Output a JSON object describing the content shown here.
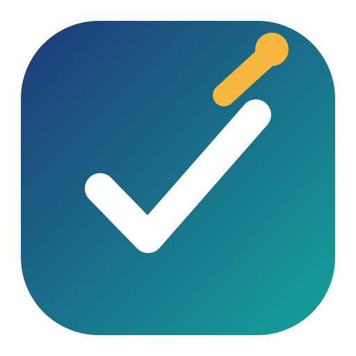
{
  "icon": {
    "name": "checkmark-app-icon",
    "gradient_start": "#1E3A78",
    "gradient_end": "#13A39A",
    "check_color": "#FFFFFF",
    "accent_color": "#F7B63E",
    "background": "#FFFFFF"
  }
}
